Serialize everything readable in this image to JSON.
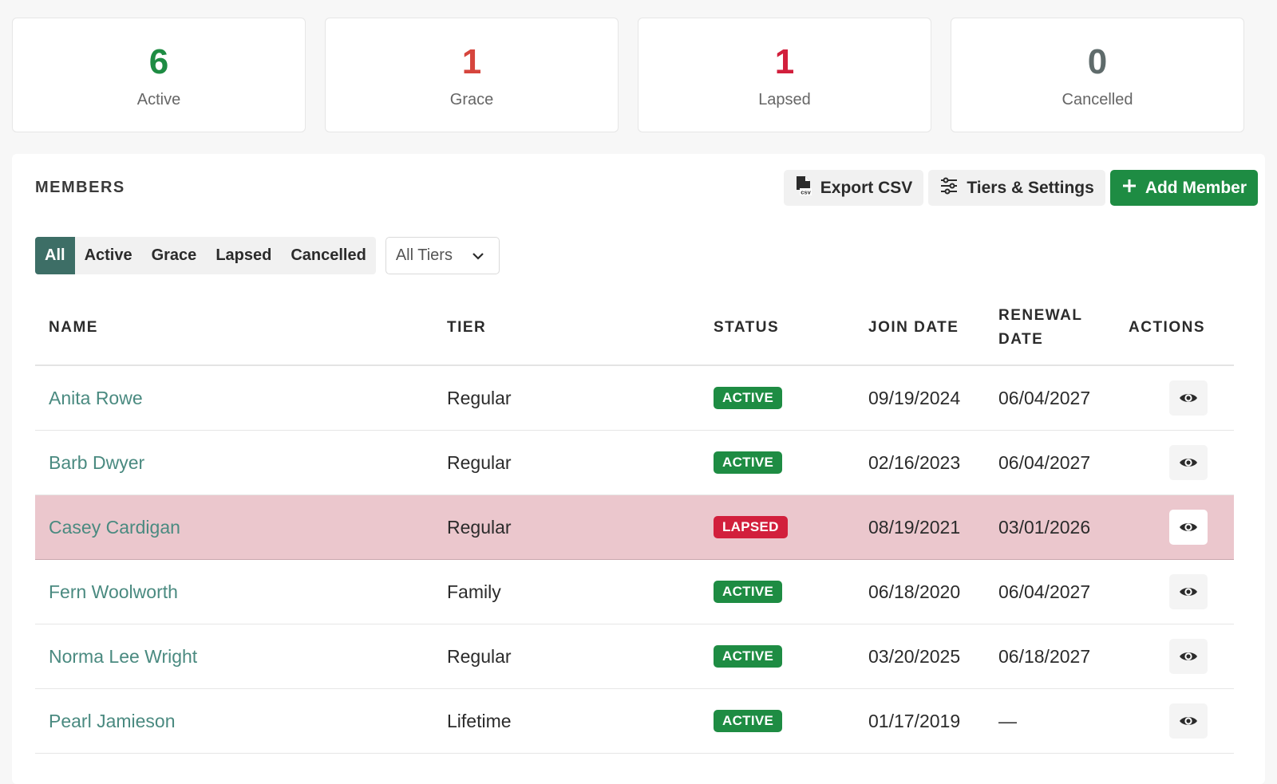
{
  "stats": [
    {
      "value": "6",
      "label": "Active",
      "color": "#1e8c43"
    },
    {
      "value": "1",
      "label": "Grace",
      "color": "#d6453d"
    },
    {
      "value": "1",
      "label": "Lapsed",
      "color": "#d21f3c"
    },
    {
      "value": "0",
      "label": "Cancelled",
      "color": "#5f6b6b"
    }
  ],
  "members_panel": {
    "title": "MEMBERS",
    "export_label": "Export CSV",
    "export_icon": "csv-file-icon",
    "settings_label": "Tiers & Settings",
    "settings_icon": "sliders-icon",
    "add_label": "Add Member",
    "add_icon": "plus-icon",
    "accent": "#1e8c43"
  },
  "filters": {
    "status_tabs": [
      "All",
      "Active",
      "Grace",
      "Lapsed",
      "Cancelled"
    ],
    "selected_tab": "All",
    "tier_select": "All Tiers"
  },
  "table": {
    "columns": {
      "name": "NAME",
      "tier": "TIER",
      "status": "STATUS",
      "join": "JOIN DATE",
      "renewal": "RENEWAL DATE",
      "actions": "ACTIONS"
    },
    "rows": [
      {
        "name": "Anita Rowe",
        "tier": "Regular",
        "status": "ACTIVE",
        "join": "09/19/2024",
        "renewal": "06/04/2027"
      },
      {
        "name": "Barb Dwyer",
        "tier": "Regular",
        "status": "ACTIVE",
        "join": "02/16/2023",
        "renewal": "06/04/2027"
      },
      {
        "name": "Casey Cardigan",
        "tier": "Regular",
        "status": "LAPSED",
        "join": "08/19/2021",
        "renewal": "03/01/2026"
      },
      {
        "name": "Fern Woolworth",
        "tier": "Family",
        "status": "ACTIVE",
        "join": "06/18/2020",
        "renewal": "06/04/2027"
      },
      {
        "name": "Norma Lee Wright",
        "tier": "Regular",
        "status": "ACTIVE",
        "join": "03/20/2025",
        "renewal": "06/18/2027"
      },
      {
        "name": "Pearl Jamieson",
        "tier": "Lifetime",
        "status": "ACTIVE",
        "join": "01/17/2019",
        "renewal": "—"
      }
    ],
    "status_colors": {
      "ACTIVE": "#1e8c43",
      "LAPSED": "#d21f3c"
    },
    "action_icon": "eye-icon"
  }
}
